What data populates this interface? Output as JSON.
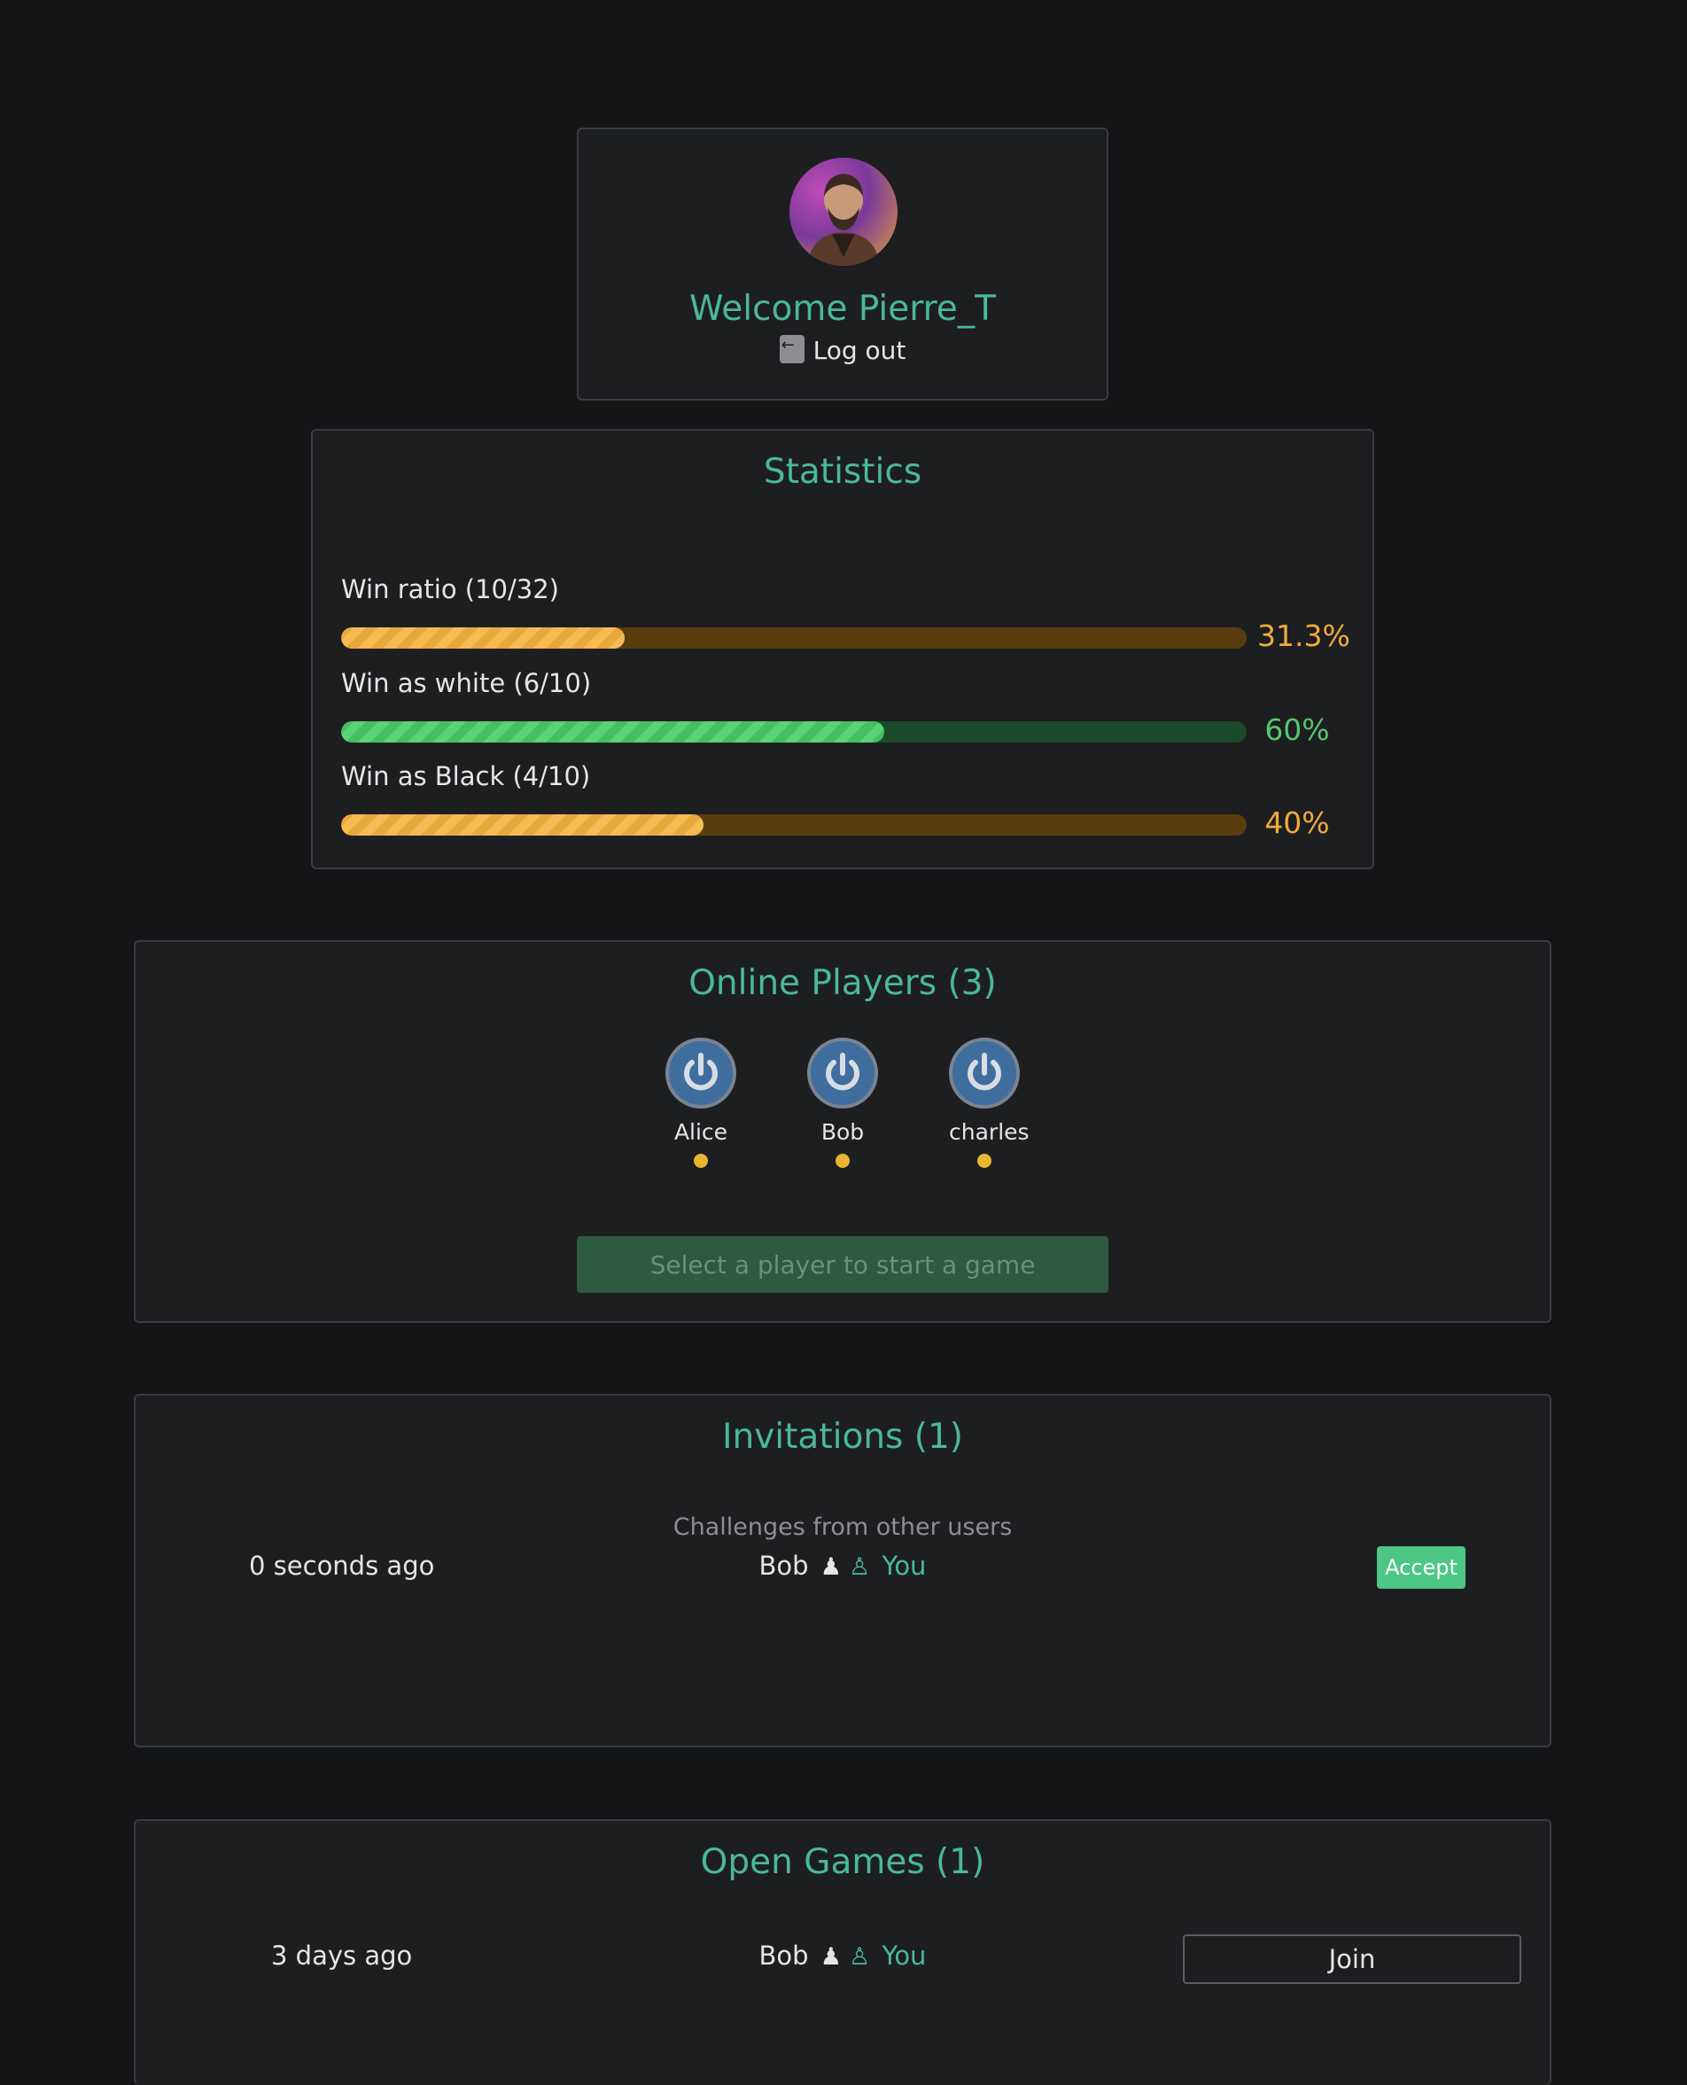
{
  "profile": {
    "welcome": "Welcome Pierre_T",
    "logout_label": "Log out"
  },
  "statistics": {
    "title": "Statistics",
    "items": [
      {
        "label": "Win ratio (10/32)",
        "percent_label": "31.3%",
        "value": 31.3,
        "color": "orange"
      },
      {
        "label": "Win as white (6/10)",
        "percent_label": "60%",
        "value": 60,
        "color": "green"
      },
      {
        "label": "Win as Black (4/10)",
        "percent_label": "40%",
        "value": 40,
        "color": "orange"
      }
    ]
  },
  "online": {
    "title": "Online Players (3)",
    "players": [
      {
        "name": "Alice",
        "icon": "power-icon",
        "status_color": "#e8b530"
      },
      {
        "name": "Bob",
        "icon": "power-icon",
        "status_color": "#e8b530"
      },
      {
        "name": "charles",
        "icon": "power-icon",
        "status_color": "#e8b530"
      }
    ],
    "start_label": "Select a player to start a game"
  },
  "invitations": {
    "title": "Invitations (1)",
    "subtitle": "Challenges from other users",
    "items": [
      {
        "time": "0 seconds ago",
        "opponent": "Bob",
        "you": "You",
        "action": "Accept"
      }
    ]
  },
  "open_games": {
    "title": "Open Games (1)",
    "items": [
      {
        "time": "3 days ago",
        "opponent": "Bob",
        "you": "You",
        "action": "Join"
      }
    ]
  },
  "colors": {
    "accent": "#4ab89a",
    "orange": "#f0ab3c",
    "green": "#55c76e",
    "accept": "#4cc784"
  }
}
